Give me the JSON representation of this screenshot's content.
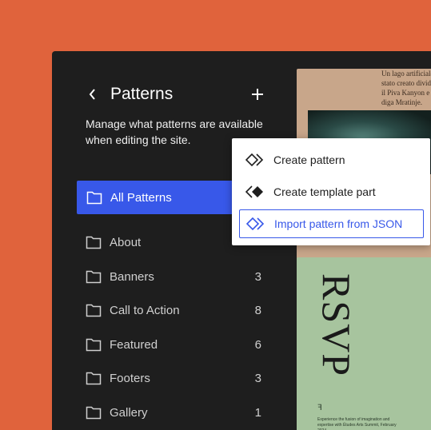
{
  "sidebar": {
    "title": "Patterns",
    "description": "Manage what patterns are available when editing the site.",
    "active_item": {
      "label": "All Patterns"
    },
    "items": [
      {
        "label": "About",
        "count": ""
      },
      {
        "label": "Banners",
        "count": "3"
      },
      {
        "label": "Call to Action",
        "count": "8"
      },
      {
        "label": "Featured",
        "count": "6"
      },
      {
        "label": "Footers",
        "count": "3"
      },
      {
        "label": "Gallery",
        "count": "1"
      }
    ]
  },
  "menu": {
    "items": [
      {
        "label": "Create pattern",
        "icon": "pattern-outline-icon"
      },
      {
        "label": "Create template part",
        "icon": "template-part-filled-icon"
      },
      {
        "label": "Import pattern from JSON",
        "icon": "import-pattern-icon",
        "selected": true
      }
    ]
  },
  "preview": {
    "card1_text": "Un lago artificiale è stato creato dividendo il Piva Kanyon e il diga Mratinje.",
    "card2_title": "RSVP",
    "card2_mark": "ꟻ",
    "card2_text": "Experience the fusion of imagination and expertise with Études Arts Summit, February 2024."
  },
  "colors": {
    "background": "#e0633c",
    "window": "#1e1e1e",
    "accent": "#3858e9",
    "card1": "#c8a68a",
    "card2": "#a7c49e"
  }
}
